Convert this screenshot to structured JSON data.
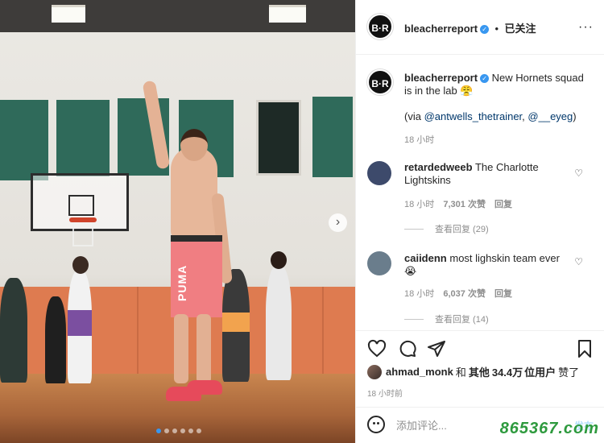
{
  "post": {
    "author": {
      "avatar_text": "B·R",
      "username": "bleacherreport",
      "follow_state": "已关注"
    },
    "caption": {
      "text": "New Hornets squad is in the lab",
      "emoji": "😤",
      "via_prefix": "(via ",
      "mention1": "@antwells_thetrainer",
      "separator": ", ",
      "mention2": "@__eyeg",
      "via_suffix": ")",
      "time": "18 小时"
    },
    "photo": {
      "shorts_text": "PUMA",
      "carousel_dots": 6,
      "active_dot": 0,
      "next_arrow": "›"
    }
  },
  "comments": [
    {
      "username": "retardedweeb",
      "text": "The Charlotte Lightskins",
      "time": "18 小时",
      "likes": "7,301 次赞",
      "reply": "回复",
      "view_replies": "查看回复 (29)",
      "avatar_color": "#3d4a6b"
    },
    {
      "username": "caiidenn",
      "text": "most lighskin team ever",
      "emoji": "😭",
      "time": "18 小时",
      "likes": "6,037 次赞",
      "reply": "回复",
      "view_replies": "查看回复 (14)",
      "avatar_color": "#6a7d8c"
    }
  ],
  "likes_summary": {
    "liker": "ahmad_monk",
    "conj": "和",
    "others": "其他",
    "count": "34.4万",
    "unit": "位用户",
    "suffix": "赞了"
  },
  "post_time": "18 小时前",
  "comment_box": {
    "placeholder": "添加评论...",
    "post_label": "发布"
  },
  "watermark": "865367.com",
  "colors": {
    "link": "#00376b",
    "verified": "#3897f0",
    "muted": "#8e8e8e"
  },
  "icons": [
    "heart-icon",
    "comment-icon",
    "share-icon",
    "bookmark-icon",
    "emoji-icon",
    "more-icon",
    "verified-icon",
    "chevron-right-icon"
  ]
}
